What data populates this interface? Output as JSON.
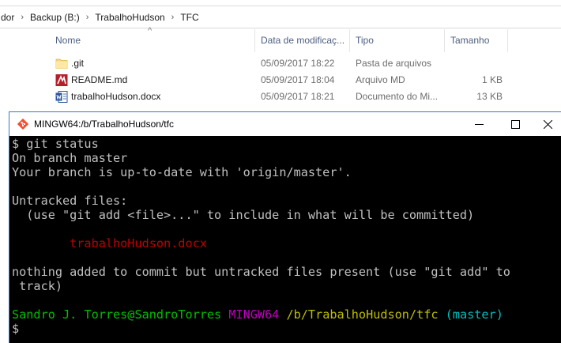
{
  "explorer": {
    "breadcrumb": [
      "dor",
      "Backup (B:)",
      "TrabalhoHudson",
      "TFC"
    ],
    "columns": {
      "name": "Nome",
      "date": "Data de modificaç...",
      "type": "Tipo",
      "size": "Tamanho"
    },
    "files": [
      {
        "name": ".git",
        "date": "05/09/2017 18:22",
        "type": "Pasta de arquivos",
        "size": "",
        "icon": "folder-icon"
      },
      {
        "name": "README.md",
        "date": "05/09/2017 18:04",
        "type": "Arquivo MD",
        "size": "1 KB",
        "icon": "md-file-icon"
      },
      {
        "name": "trabalhoHudson.docx",
        "date": "05/09/2017 18:21",
        "type": "Documento do Mi...",
        "size": "13 KB",
        "icon": "word-document-icon"
      }
    ]
  },
  "terminal": {
    "title": "MINGW64:/b/TrabalhoHudson/tfc",
    "lines": {
      "cmd": "$ git status",
      "branch": "On branch master",
      "uptodate": "Your branch is up-to-date with 'origin/master'.",
      "untracked_header": "Untracked files:",
      "untracked_hint": "  (use \"git add <file>...\" to include in what will be committed)",
      "untracked_file": "        trabalhoHudson.docx",
      "nothing_1": "nothing added to commit but untracked files present (use \"git add\" to",
      "nothing_2": " track)",
      "prompt_user": "Sandro J. Torres@SandroTorres",
      "prompt_env": "MINGW64",
      "prompt_path": "/b/TrabalhoHudson/tfc",
      "prompt_branch": "(master)",
      "prompt_symbol": "$"
    }
  },
  "colors": {
    "terminal_bg": "#000000",
    "terminal_fg": "#c0c0c0",
    "untracked_red": "#bf0000",
    "prompt_green": "#00bf00",
    "prompt_magenta": "#bf00bf",
    "prompt_yellow": "#bfbf00",
    "prompt_cyan": "#00bfbf",
    "window_border": "#3a78c6"
  }
}
